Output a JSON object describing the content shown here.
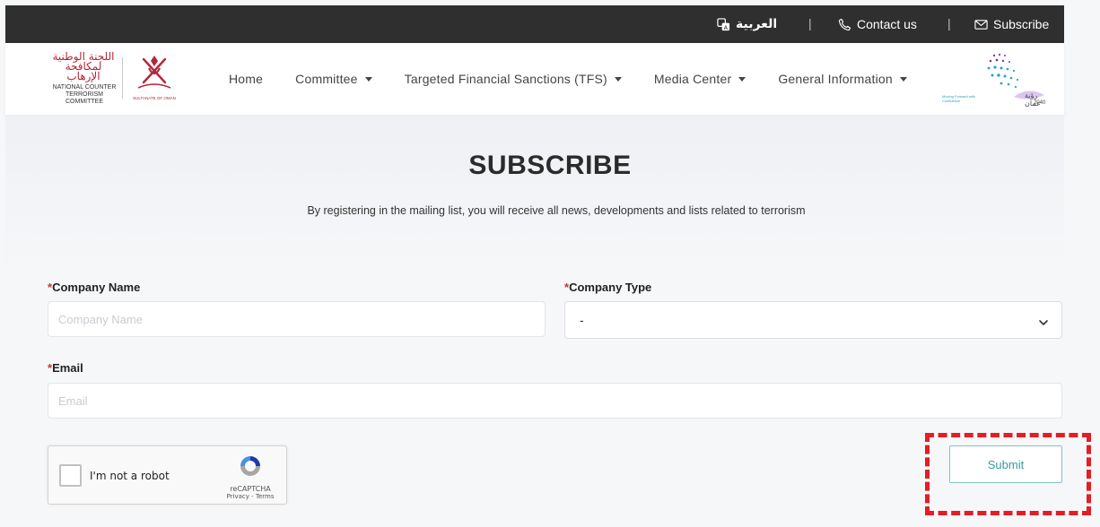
{
  "topbar": {
    "language_label": "العربية",
    "contact_label": "Contact us",
    "subscribe_label": "Subscribe",
    "separator": "|"
  },
  "logo_left": {
    "arabic_text": "اللجنة الوطنية لمكافحة الإرهاب",
    "english_line1": "NATIONAL COUNTER",
    "english_line2": "TERRORISM COMMITTEE",
    "emblem_caption": "SULTANATE OF OMAN"
  },
  "nav": {
    "items": [
      {
        "label": "Home",
        "has_dropdown": false
      },
      {
        "label": "Committee",
        "has_dropdown": true
      },
      {
        "label": "Targeted Financial Sanctions (TFS)",
        "has_dropdown": true
      },
      {
        "label": "Media Center",
        "has_dropdown": true
      },
      {
        "label": "General Information",
        "has_dropdown": true
      }
    ]
  },
  "logo_right": {
    "caption_ar": "رؤية عمان",
    "year": "2040",
    "tagline": "Moving Forward with Confidence"
  },
  "hero": {
    "title": "SUBSCRIBE",
    "subtitle": "By registering in the mailing list, you will receive all news, developments and lists related to terrorism"
  },
  "form": {
    "required_mark": "*",
    "company_name": {
      "label": "Company Name",
      "placeholder": "Company Name",
      "value": ""
    },
    "company_type": {
      "label": "Company Type",
      "selected": "-"
    },
    "email": {
      "label": "Email",
      "placeholder": "Email",
      "value": ""
    },
    "submit_label": "Submit"
  },
  "recaptcha": {
    "label": "I'm not a robot",
    "brand": "reCAPTCHA",
    "links": "Privacy - Terms"
  },
  "colors": {
    "topbar_bg": "#2f2f2f",
    "required": "#c0392b",
    "submit_border": "#7fc4c4",
    "highlight": "#e31e24"
  }
}
